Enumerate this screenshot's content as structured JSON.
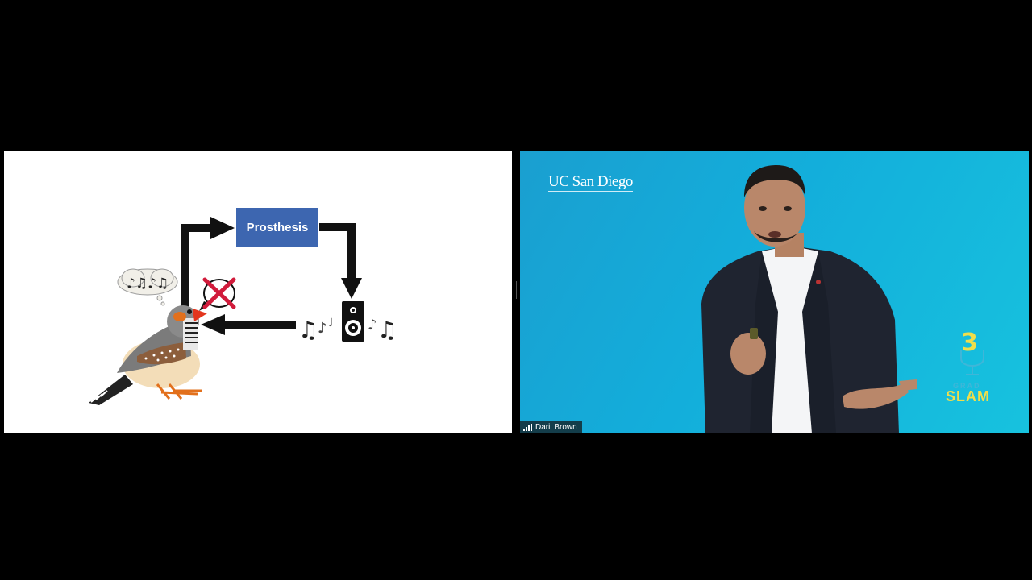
{
  "slide": {
    "box_label": "Prosthesis",
    "colors": {
      "box": "#3d66b0",
      "cross": "#d11b3b",
      "arrow": "#111111"
    }
  },
  "video": {
    "logo_text": "UC San Diego",
    "badge_number": "3",
    "badge_top": "GRAD",
    "badge_bottom": "SLAM",
    "participant_name": "Daril Brown",
    "signal_icon": "signal-bars-icon"
  }
}
